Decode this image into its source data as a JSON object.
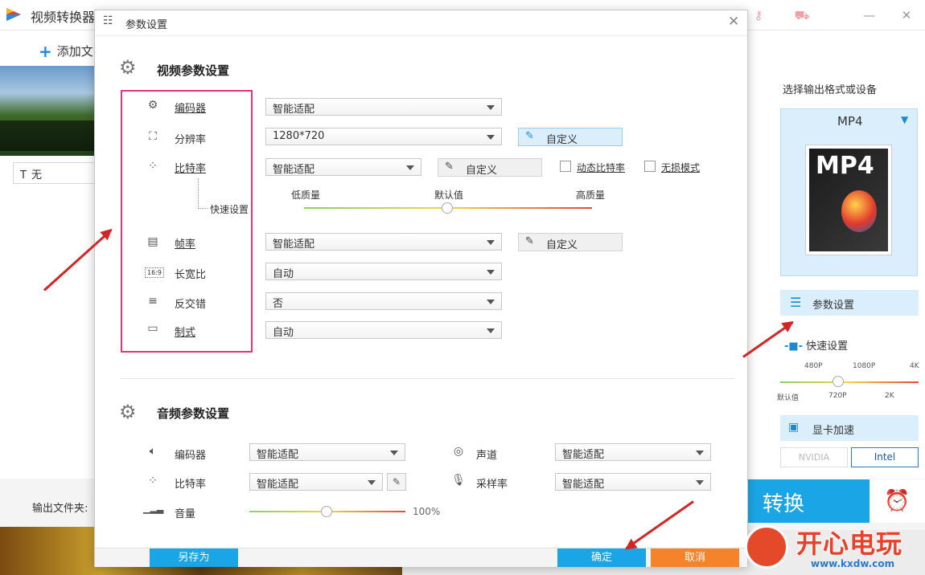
{
  "app": {
    "title": "视频转换器",
    "add_file": "添加文",
    "text_select": "无",
    "output_folder_label": "输出文件夹:",
    "convert": "转换"
  },
  "right_panel": {
    "choose_format": "选择输出格式或设备",
    "format": "MP4",
    "format_image_text": "MP4",
    "param_settings": "参数设置",
    "quick_settings": "快速设置",
    "res_ticks_top": [
      "480P",
      "1080P",
      "4K"
    ],
    "res_ticks_bottom": [
      "默认值",
      "720P",
      "2K"
    ],
    "gpu_accel": "显卡加速",
    "nvidia": "NVIDIA",
    "intel": "Intel"
  },
  "dialog": {
    "title": "参数设置",
    "video_section": "视频参数设置",
    "audio_section": "音频参数设置",
    "video": {
      "encoder": {
        "label": "编码器",
        "value": "智能适配"
      },
      "resolution": {
        "label": "分辨率",
        "value": "1280*720",
        "custom": "自定义"
      },
      "bitrate": {
        "label": "比特率",
        "value": "智能适配",
        "custom": "自定义",
        "dynamic": "动态比特率",
        "lossless": "无损模式"
      },
      "quick": {
        "label": "快速设置",
        "low": "低质量",
        "default": "默认值",
        "high": "高质量"
      },
      "framerate": {
        "label": "帧率",
        "value": "智能适配",
        "custom": "自定义"
      },
      "aspect": {
        "label": "长宽比",
        "value": "自动",
        "icon_text": "16:9"
      },
      "deinterlace": {
        "label": "反交错",
        "value": "否"
      },
      "standard": {
        "label": "制式",
        "value": "自动"
      }
    },
    "audio": {
      "encoder": {
        "label": "编码器",
        "value": "智能适配"
      },
      "bitrate": {
        "label": "比特率",
        "value": "智能适配"
      },
      "volume": {
        "label": "音量",
        "value": "100%"
      },
      "channel": {
        "label": "声道",
        "value": "智能适配"
      },
      "samplerate": {
        "label": "采样率",
        "value": "智能适配"
      }
    },
    "buttons": {
      "save_as": "另存为",
      "ok": "确定",
      "cancel": "取消"
    }
  },
  "watermark": {
    "text": "开心电玩",
    "url": "www.kxdw.com"
  },
  "colors": {
    "accent": "#1aa6e6",
    "highlight_box": "#e6337a",
    "arrow": "#d42424",
    "cancel": "#f5832a"
  }
}
